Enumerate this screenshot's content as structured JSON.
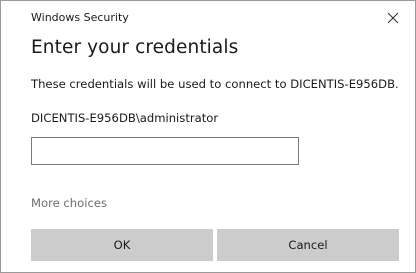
{
  "window": {
    "title": "Windows Security",
    "close_icon": "close-icon"
  },
  "dialog": {
    "heading": "Enter your credentials",
    "description": "These credentials will be used to connect to DICENTIS-E956DB.",
    "username": "DICENTIS-E956DB\\administrator",
    "password_value": "",
    "more_choices_label": "More choices",
    "ok_label": "OK",
    "cancel_label": "Cancel"
  },
  "colors": {
    "button_background": "#cccccc",
    "link_text": "#6e6e6e",
    "input_border": "#7a7a7a"
  }
}
